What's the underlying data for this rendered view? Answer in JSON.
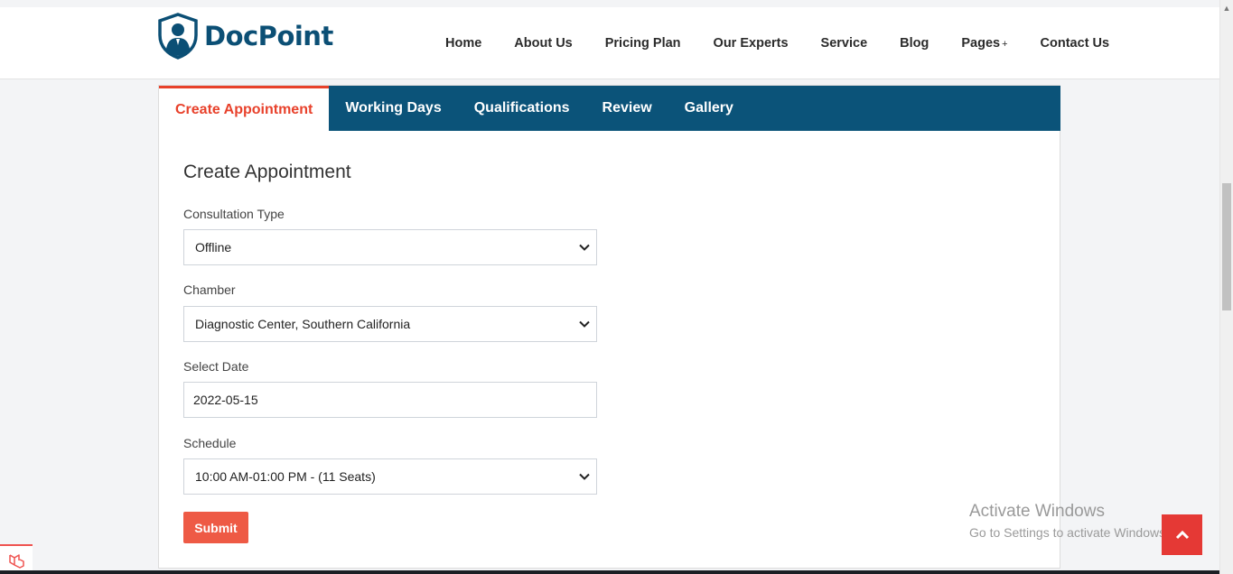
{
  "brand": {
    "name": "DocPoint",
    "logo_icon": "doctor-shield-icon",
    "color": "#0b4f75"
  },
  "nav": {
    "items": [
      {
        "label": "Home"
      },
      {
        "label": "About Us"
      },
      {
        "label": "Pricing Plan"
      },
      {
        "label": "Our Experts"
      },
      {
        "label": "Service"
      },
      {
        "label": "Blog"
      },
      {
        "label": "Pages",
        "suffix": "+"
      },
      {
        "label": "Contact Us"
      }
    ]
  },
  "tabs": [
    {
      "label": "Create Appointment",
      "active": true
    },
    {
      "label": "Working Days"
    },
    {
      "label": "Qualifications"
    },
    {
      "label": "Review"
    },
    {
      "label": "Gallery"
    }
  ],
  "form": {
    "title": "Create Appointment",
    "consultation_type": {
      "label": "Consultation Type",
      "value": "Offline"
    },
    "chamber": {
      "label": "Chamber",
      "value": "Diagnostic Center, Southern California"
    },
    "date": {
      "label": "Select Date",
      "value": "2022-05-15"
    },
    "schedule": {
      "label": "Schedule",
      "value": "10:00 AM-01:00 PM - (11 Seats)"
    },
    "submit_label": "Submit"
  },
  "watermark": {
    "line1": "Activate Windows",
    "line2": "Go to Settings to activate Windows."
  },
  "colors": {
    "tab_bar": "#0b5379",
    "accent": "#e8412b",
    "submit": "#ee5a45",
    "to_top": "#e53935"
  }
}
